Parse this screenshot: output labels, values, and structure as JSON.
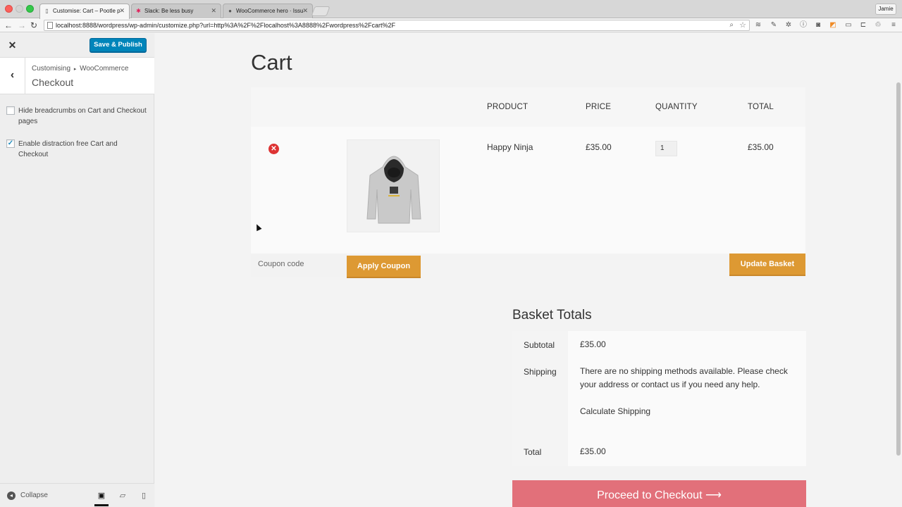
{
  "browser": {
    "tabs": [
      {
        "title": "Customise: Cart – Pootle p"
      },
      {
        "title": "Slack: Be less busy"
      },
      {
        "title": "WooCommerce hero · Issu"
      }
    ],
    "profile": "Jamie",
    "url": "localhost:8888/wordpress/wp-admin/customize.php?url=http%3A%2F%2Flocalhost%3A8888%2Fwordpress%2Fcart%2F"
  },
  "sidebar": {
    "publish_label": "Save & Publish",
    "breadcrumb_root": "Customising",
    "breadcrumb_section": "WooCommerce",
    "section_title": "Checkout",
    "options": [
      {
        "label": "Hide breadcrumbs on Cart and Checkout pages",
        "checked": false
      },
      {
        "label": "Enable distraction free Cart and Checkout",
        "checked": true
      }
    ],
    "collapse_label": "Collapse"
  },
  "cart": {
    "page_title": "Cart",
    "headers": {
      "product": "PRODUCT",
      "price": "PRICE",
      "quantity": "QUANTITY",
      "total": "TOTAL"
    },
    "item": {
      "name": "Happy Ninja",
      "price": "£35.00",
      "quantity": "1",
      "total": "£35.00"
    },
    "coupon_placeholder": "Coupon code",
    "apply_coupon_label": "Apply Coupon",
    "update_basket_label": "Update Basket"
  },
  "totals": {
    "title": "Basket Totals",
    "subtotal_label": "Subtotal",
    "subtotal_value": "£35.00",
    "shipping_label": "Shipping",
    "shipping_text": "There are no shipping methods available. Please check your address or contact us if you need any help.",
    "calculate_shipping": "Calculate Shipping",
    "total_label": "Total",
    "total_value": "£35.00",
    "checkout_label": "Proceed to Checkout"
  },
  "colors": {
    "publish": "#0085ba",
    "orange_button": "#dd9933",
    "checkout_button": "#e2707a",
    "remove_icon": "#dd3333"
  }
}
